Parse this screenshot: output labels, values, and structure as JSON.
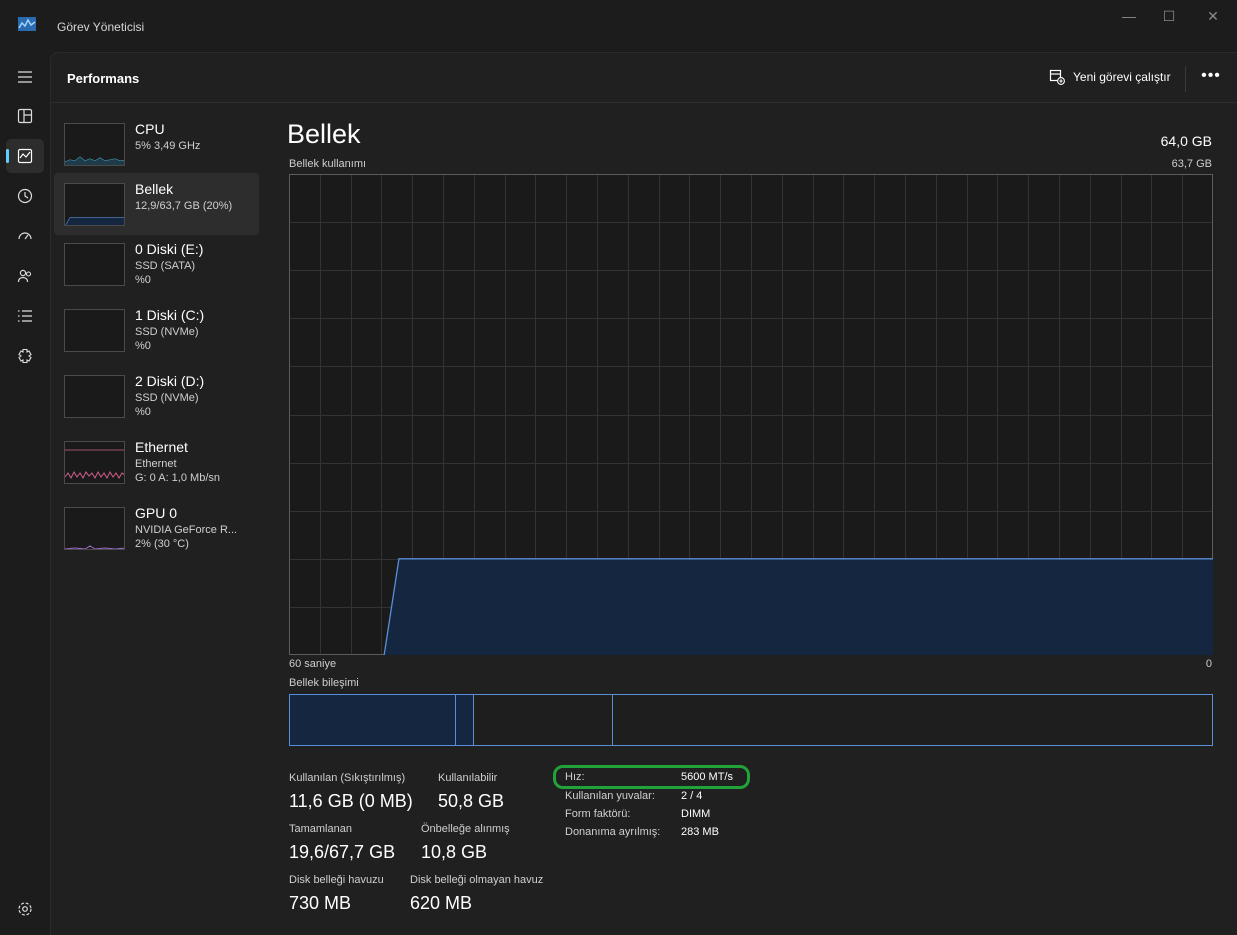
{
  "window": {
    "title": "Görev Yöneticisi",
    "controls": {
      "minimize": "—",
      "maximize": "☐",
      "close": "✕"
    }
  },
  "nav_rail": {
    "items": [
      {
        "icon": "hamburger-menu-icon"
      },
      {
        "icon": "processes-icon"
      },
      {
        "icon": "performance-icon",
        "active": true
      },
      {
        "icon": "app-history-icon"
      },
      {
        "icon": "startup-apps-icon"
      },
      {
        "icon": "users-icon"
      },
      {
        "icon": "details-icon"
      },
      {
        "icon": "services-icon"
      },
      {
        "icon": "settings-icon"
      }
    ]
  },
  "header": {
    "title": "Performans",
    "run_task_label": "Yeni görevi çalıştır",
    "more_label": "•••"
  },
  "devices": [
    {
      "name": "CPU",
      "line1": "5%  3,49 GHz",
      "line2": ""
    },
    {
      "name": "Bellek",
      "line1": "12,9/63,7 GB (20%)",
      "line2": "",
      "selected": true
    },
    {
      "name": "0 Diski (E:)",
      "line1": "SSD (SATA)",
      "line2": "%0"
    },
    {
      "name": "1 Diski (C:)",
      "line1": "SSD (NVMe)",
      "line2": "%0"
    },
    {
      "name": "2 Diski (D:)",
      "line1": "SSD (NVMe)",
      "line2": "%0"
    },
    {
      "name": "Ethernet",
      "line1": "Ethernet",
      "line2": "G: 0 A: 1,0 Mb/sn"
    },
    {
      "name": "GPU 0",
      "line1": "NVIDIA GeForce R...",
      "line2": "2%  (30 °C)"
    }
  ],
  "memory": {
    "title": "Bellek",
    "total": "64,0 GB",
    "usage_label": "Bellek kullanımı",
    "usage_max": "63,7 GB",
    "axis_left": "60 saniye",
    "axis_right": "0",
    "composition_label": "Bellek bileşimi",
    "usage_fraction": 0.2,
    "composition_fractions": {
      "in_use": 0.18,
      "modified": 0.02,
      "standby": 0.15
    },
    "stats": {
      "in_use_label": "Kullanılan (Sıkıştırılmış)",
      "in_use_value": "11,6 GB (0 MB)",
      "available_label": "Kullanılabilir",
      "available_value": "50,8 GB",
      "committed_label": "Tamamlanan",
      "committed_value": "19,6/67,7 GB",
      "cached_label": "Önbelleğe alınmış",
      "cached_value": "10,8 GB",
      "paged_label": "Disk belleği havuzu",
      "paged_value": "730 MB",
      "nonpaged_label": "Disk belleği olmayan havuz",
      "nonpaged_value": "620 MB"
    },
    "details": {
      "speed_label": "Hız:",
      "speed_value": "5600 MT/s",
      "slots_label": "Kullanılan yuvalar:",
      "slots_value": "2 / 4",
      "form_label": "Form faktörü:",
      "form_value": "DIMM",
      "reserved_label": "Donanıma ayrılmış:",
      "reserved_value": "283 MB"
    }
  },
  "colors": {
    "accent": "#60cdff",
    "memory_line": "#5a8ed6",
    "memory_fill": "#142640",
    "ethernet": "#d35f8c",
    "highlight": "#22a339"
  }
}
